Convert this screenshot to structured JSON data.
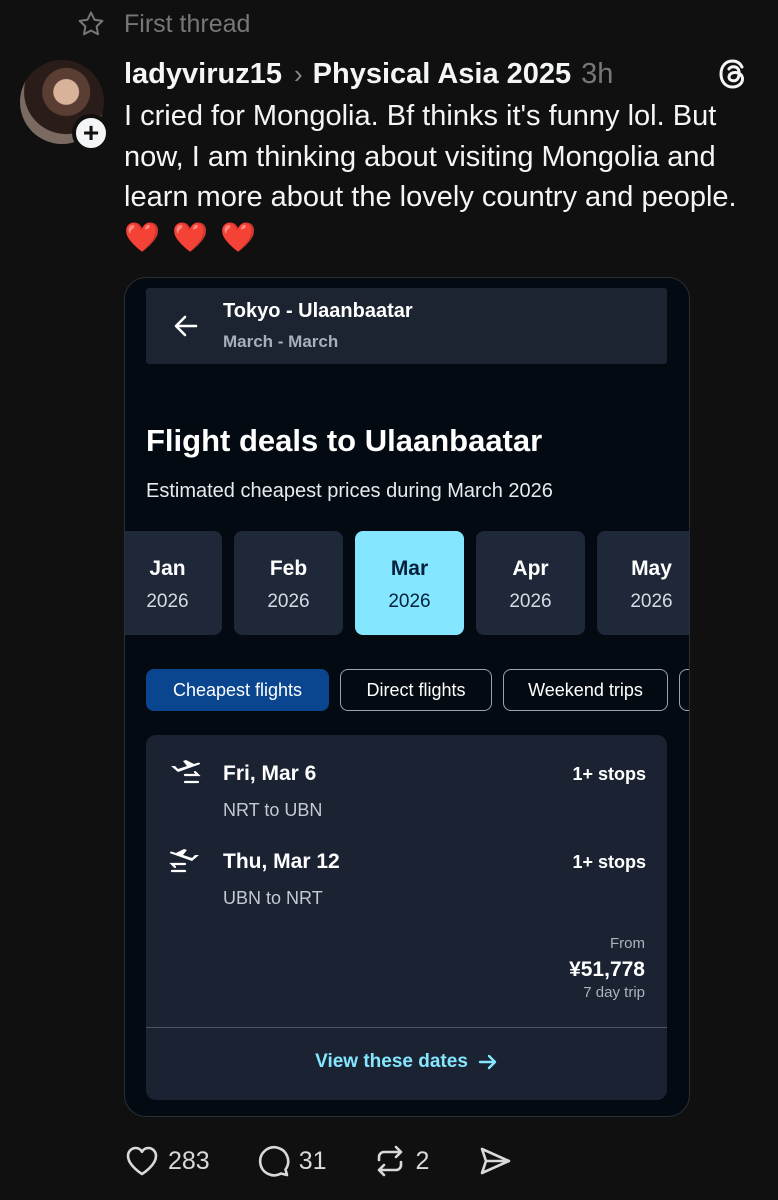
{
  "thread_label": "First thread",
  "post": {
    "username": "ladyviruz15",
    "topic": "Physical Asia 2025",
    "time": "3h",
    "text": "I cried for Mongolia. Bf thinks it's funny lol. But now, I am thinking about visiting Mongolia and learn more about the lovely country and people.",
    "hearts": "❤️ ❤️ ❤️"
  },
  "screenshot": {
    "route_title": "Tokyo - Ulaanbaatar",
    "route_subtitle": "March - March",
    "deals_title": "Flight deals to Ulaanbaatar",
    "deals_subtitle": "Estimated cheapest prices during March 2026",
    "months": [
      {
        "month": "Jan",
        "year": "2026"
      },
      {
        "month": "Feb",
        "year": "2026"
      },
      {
        "month": "Mar",
        "year": "2026"
      },
      {
        "month": "Apr",
        "year": "2026"
      },
      {
        "month": "May",
        "year": "2026"
      }
    ],
    "selected_month": "Mar",
    "filters": [
      "Cheapest flights",
      "Direct flights",
      "Weekend trips"
    ],
    "legs": [
      {
        "date": "Fri, Mar 6",
        "route": "NRT to UBN",
        "stops": "1+ stops"
      },
      {
        "date": "Thu, Mar 12",
        "route": "UBN to NRT",
        "stops": "1+ stops"
      }
    ],
    "from_label": "From",
    "price": "¥51,778",
    "trip_length": "7 day trip",
    "cta": "View these dates"
  },
  "actions": {
    "likes": "283",
    "replies": "31",
    "reposts": "2"
  },
  "colors": {
    "background": "#101010",
    "card_background": "#040a12",
    "accent_cyan": "#84e7ff",
    "active_chip": "#0a4590",
    "heart_red": "#e8252f"
  }
}
